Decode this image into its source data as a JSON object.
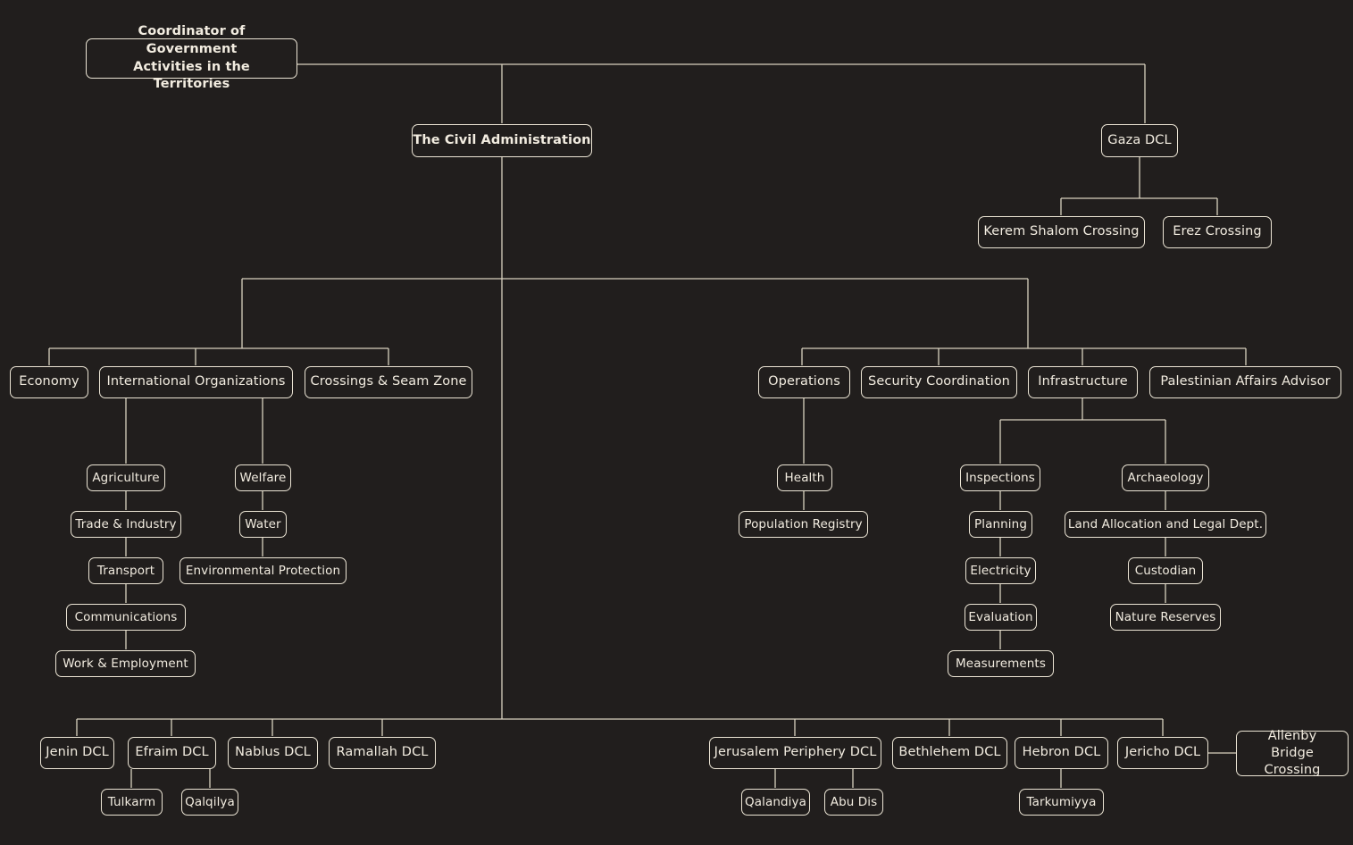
{
  "diagram": {
    "title": "Coordinator of Government Activities in the Territories organizational chart",
    "background_color": "#211e1d",
    "node_border_color": "#ece5d5",
    "edge_color": "#d9d2c0",
    "text_color": "#f2ece0"
  },
  "nodes": {
    "cogat": "Coordinator of Government\nActivities in the Territories",
    "cogat_line1": "Coordinator of Government",
    "cogat_line2": "Activities in the Territories",
    "civil_administration": "The Civil Administration",
    "gaza_dcl": "Gaza DCL",
    "kerem_shalom": "Kerem Shalom Crossing",
    "erez": "Erez Crossing",
    "economy": "Economy",
    "international_organizations": "International Organizations",
    "crossings_seam_zone": "Crossings & Seam Zone",
    "agriculture": "Agriculture",
    "trade_industry": "Trade & Industry",
    "transport": "Transport",
    "communications": "Communications",
    "work_employment": "Work & Employment",
    "welfare": "Welfare",
    "water": "Water",
    "environmental_protection": "Environmental Protection",
    "operations": "Operations",
    "security_coordination": "Security Coordination",
    "infrastructure": "Infrastructure",
    "palestinian_affairs_advisor": "Palestinian Affairs Advisor",
    "health": "Health",
    "population_registry": "Population Registry",
    "inspections": "Inspections",
    "planning": "Planning",
    "electricity": "Electricity",
    "evaluation": "Evaluation",
    "measurements": "Measurements",
    "archaeology": "Archaeology",
    "land_allocation": "Land Allocation and Legal Dept.",
    "custodian": "Custodian",
    "nature_reserves": "Nature Reserves",
    "jenin_dcl": "Jenin DCL",
    "efraim_dcl": "Efraim DCL",
    "nablus_dcl": "Nablus DCL",
    "ramallah_dcl": "Ramallah DCL",
    "tulkarm": "Tulkarm",
    "qalqilya": "Qalqilya",
    "jerusalem_periphery_dcl": "Jerusalem Periphery DCL",
    "bethlehem_dcl": "Bethlehem DCL",
    "hebron_dcl": "Hebron DCL",
    "jericho_dcl": "Jericho DCL",
    "allenby_bridge_crossing": "Allenby Bridge\nCrossing",
    "allenby_line1": "Allenby Bridge",
    "allenby_line2": "Crossing",
    "qalandiya": "Qalandiya",
    "abu_dis": "Abu Dis",
    "tarkumiyya": "Tarkumiyya"
  },
  "hierarchy": {
    "root": "cogat",
    "edges": [
      [
        "cogat",
        "civil_administration"
      ],
      [
        "cogat",
        "gaza_dcl"
      ],
      [
        "gaza_dcl",
        "kerem_shalom"
      ],
      [
        "gaza_dcl",
        "erez"
      ],
      [
        "civil_administration",
        "economy"
      ],
      [
        "civil_administration",
        "international_organizations"
      ],
      [
        "civil_administration",
        "crossings_seam_zone"
      ],
      [
        "civil_administration",
        "operations"
      ],
      [
        "civil_administration",
        "security_coordination"
      ],
      [
        "civil_administration",
        "infrastructure"
      ],
      [
        "civil_administration",
        "palestinian_affairs_advisor"
      ],
      [
        "international_organizations",
        "agriculture"
      ],
      [
        "agriculture",
        "trade_industry"
      ],
      [
        "trade_industry",
        "transport"
      ],
      [
        "transport",
        "communications"
      ],
      [
        "communications",
        "work_employment"
      ],
      [
        "international_organizations",
        "welfare"
      ],
      [
        "welfare",
        "water"
      ],
      [
        "water",
        "environmental_protection"
      ],
      [
        "operations",
        "health"
      ],
      [
        "health",
        "population_registry"
      ],
      [
        "infrastructure",
        "inspections"
      ],
      [
        "inspections",
        "planning"
      ],
      [
        "planning",
        "electricity"
      ],
      [
        "electricity",
        "evaluation"
      ],
      [
        "evaluation",
        "measurements"
      ],
      [
        "infrastructure",
        "archaeology"
      ],
      [
        "archaeology",
        "land_allocation"
      ],
      [
        "land_allocation",
        "custodian"
      ],
      [
        "custodian",
        "nature_reserves"
      ],
      [
        "civil_administration",
        "jenin_dcl"
      ],
      [
        "civil_administration",
        "efraim_dcl"
      ],
      [
        "civil_administration",
        "nablus_dcl"
      ],
      [
        "civil_administration",
        "ramallah_dcl"
      ],
      [
        "civil_administration",
        "jerusalem_periphery_dcl"
      ],
      [
        "civil_administration",
        "bethlehem_dcl"
      ],
      [
        "civil_administration",
        "hebron_dcl"
      ],
      [
        "civil_administration",
        "jericho_dcl"
      ],
      [
        "efraim_dcl",
        "tulkarm"
      ],
      [
        "efraim_dcl",
        "qalqilya"
      ],
      [
        "jerusalem_periphery_dcl",
        "qalandiya"
      ],
      [
        "jerusalem_periphery_dcl",
        "abu_dis"
      ],
      [
        "hebron_dcl",
        "tarkumiyya"
      ],
      [
        "jericho_dcl",
        "allenby_bridge_crossing"
      ]
    ]
  }
}
